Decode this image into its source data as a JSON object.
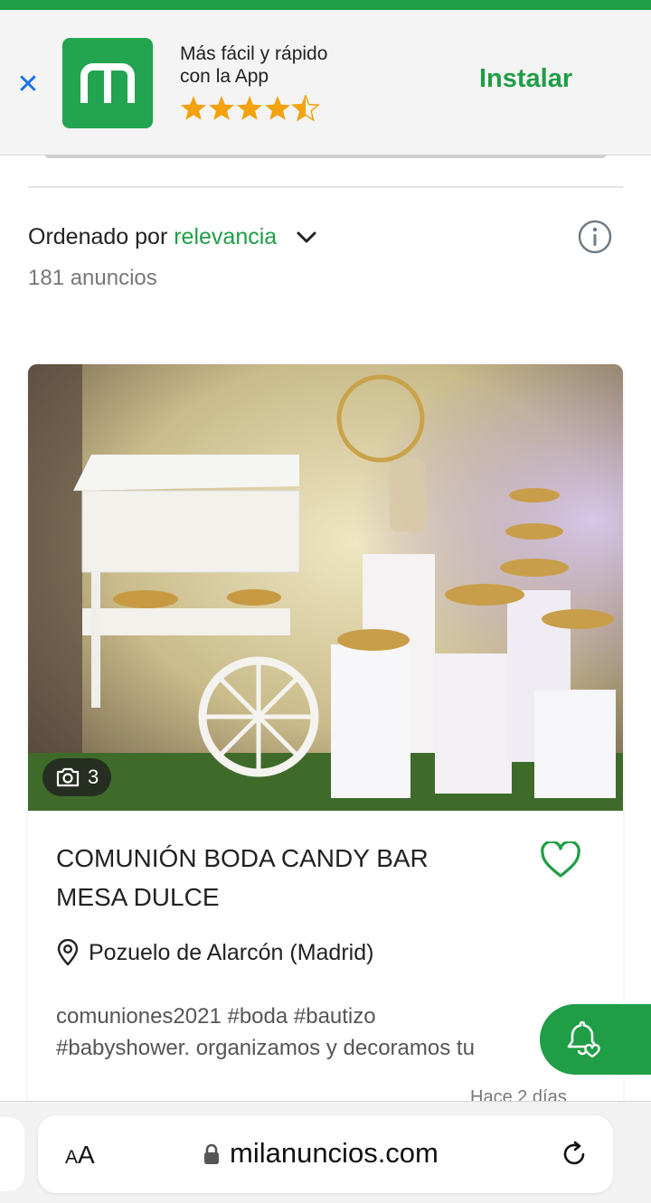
{
  "app_banner": {
    "close_icon": "close-icon",
    "line1": "Más fácil y rápido",
    "line2": "con la App",
    "rating_stars": "★★★★⯪",
    "rating_value": 4.5,
    "install_label": "Instalar",
    "colors": {
      "brand": "#1f9e46",
      "stars": "#f2a20d",
      "close": "#1a73e8"
    }
  },
  "listing_header": {
    "sort_prefix": "Ordenado por",
    "sort_value": "relevancia",
    "count_text": "181 anuncios"
  },
  "card": {
    "photo_count": "3",
    "title_line1": "COMUNIÓN BODA CANDY BAR",
    "title_line2": "MESA DULCE",
    "location": "Pozuelo de Alarcón (Madrid)",
    "desc_line1": "comuniones2021 #boda #bautizo",
    "desc_line2": "#babyshower. organizamos y decoramos tu",
    "date": "Hace 2 días"
  },
  "browser": {
    "aa_label_big": "A",
    "aa_label_small": "A",
    "domain": "milanuncios.com"
  }
}
